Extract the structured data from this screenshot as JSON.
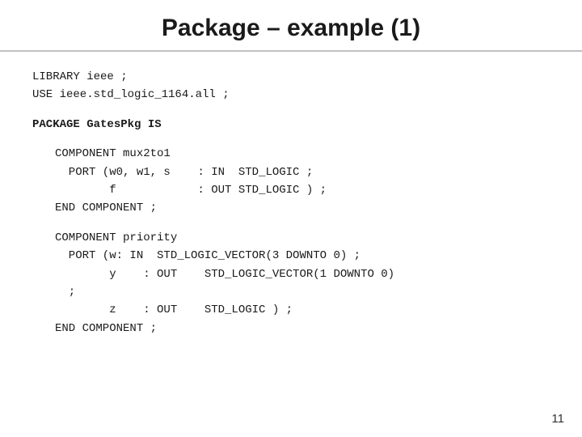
{
  "title": "Package – example (1)",
  "code": {
    "library_line1": "LIBRARY ieee ;",
    "library_line2": "USE ieee.std_logic_1164.all ;",
    "package_header": "PACKAGE GatesPkg IS",
    "component1": {
      "line1": "COMPONENT mux2to1",
      "line2": "  PORT (w0, w1, s    : IN  STD_LOGIC ;",
      "line3": "        f            : OUT STD_LOGIC ) ;",
      "line4": "END COMPONENT ;"
    },
    "component2": {
      "line1": "COMPONENT priority",
      "line2": "  PORT (w: IN  STD_LOGIC_VECTOR(3 DOWNTO 0) ;",
      "line3": "        y    : OUT    STD_LOGIC_VECTOR(1 DOWNTO 0)",
      "line4": "  ;",
      "line5": "        z    : OUT    STD_LOGIC ) ;",
      "line6": "END COMPONENT ;"
    }
  },
  "page_number": "11"
}
